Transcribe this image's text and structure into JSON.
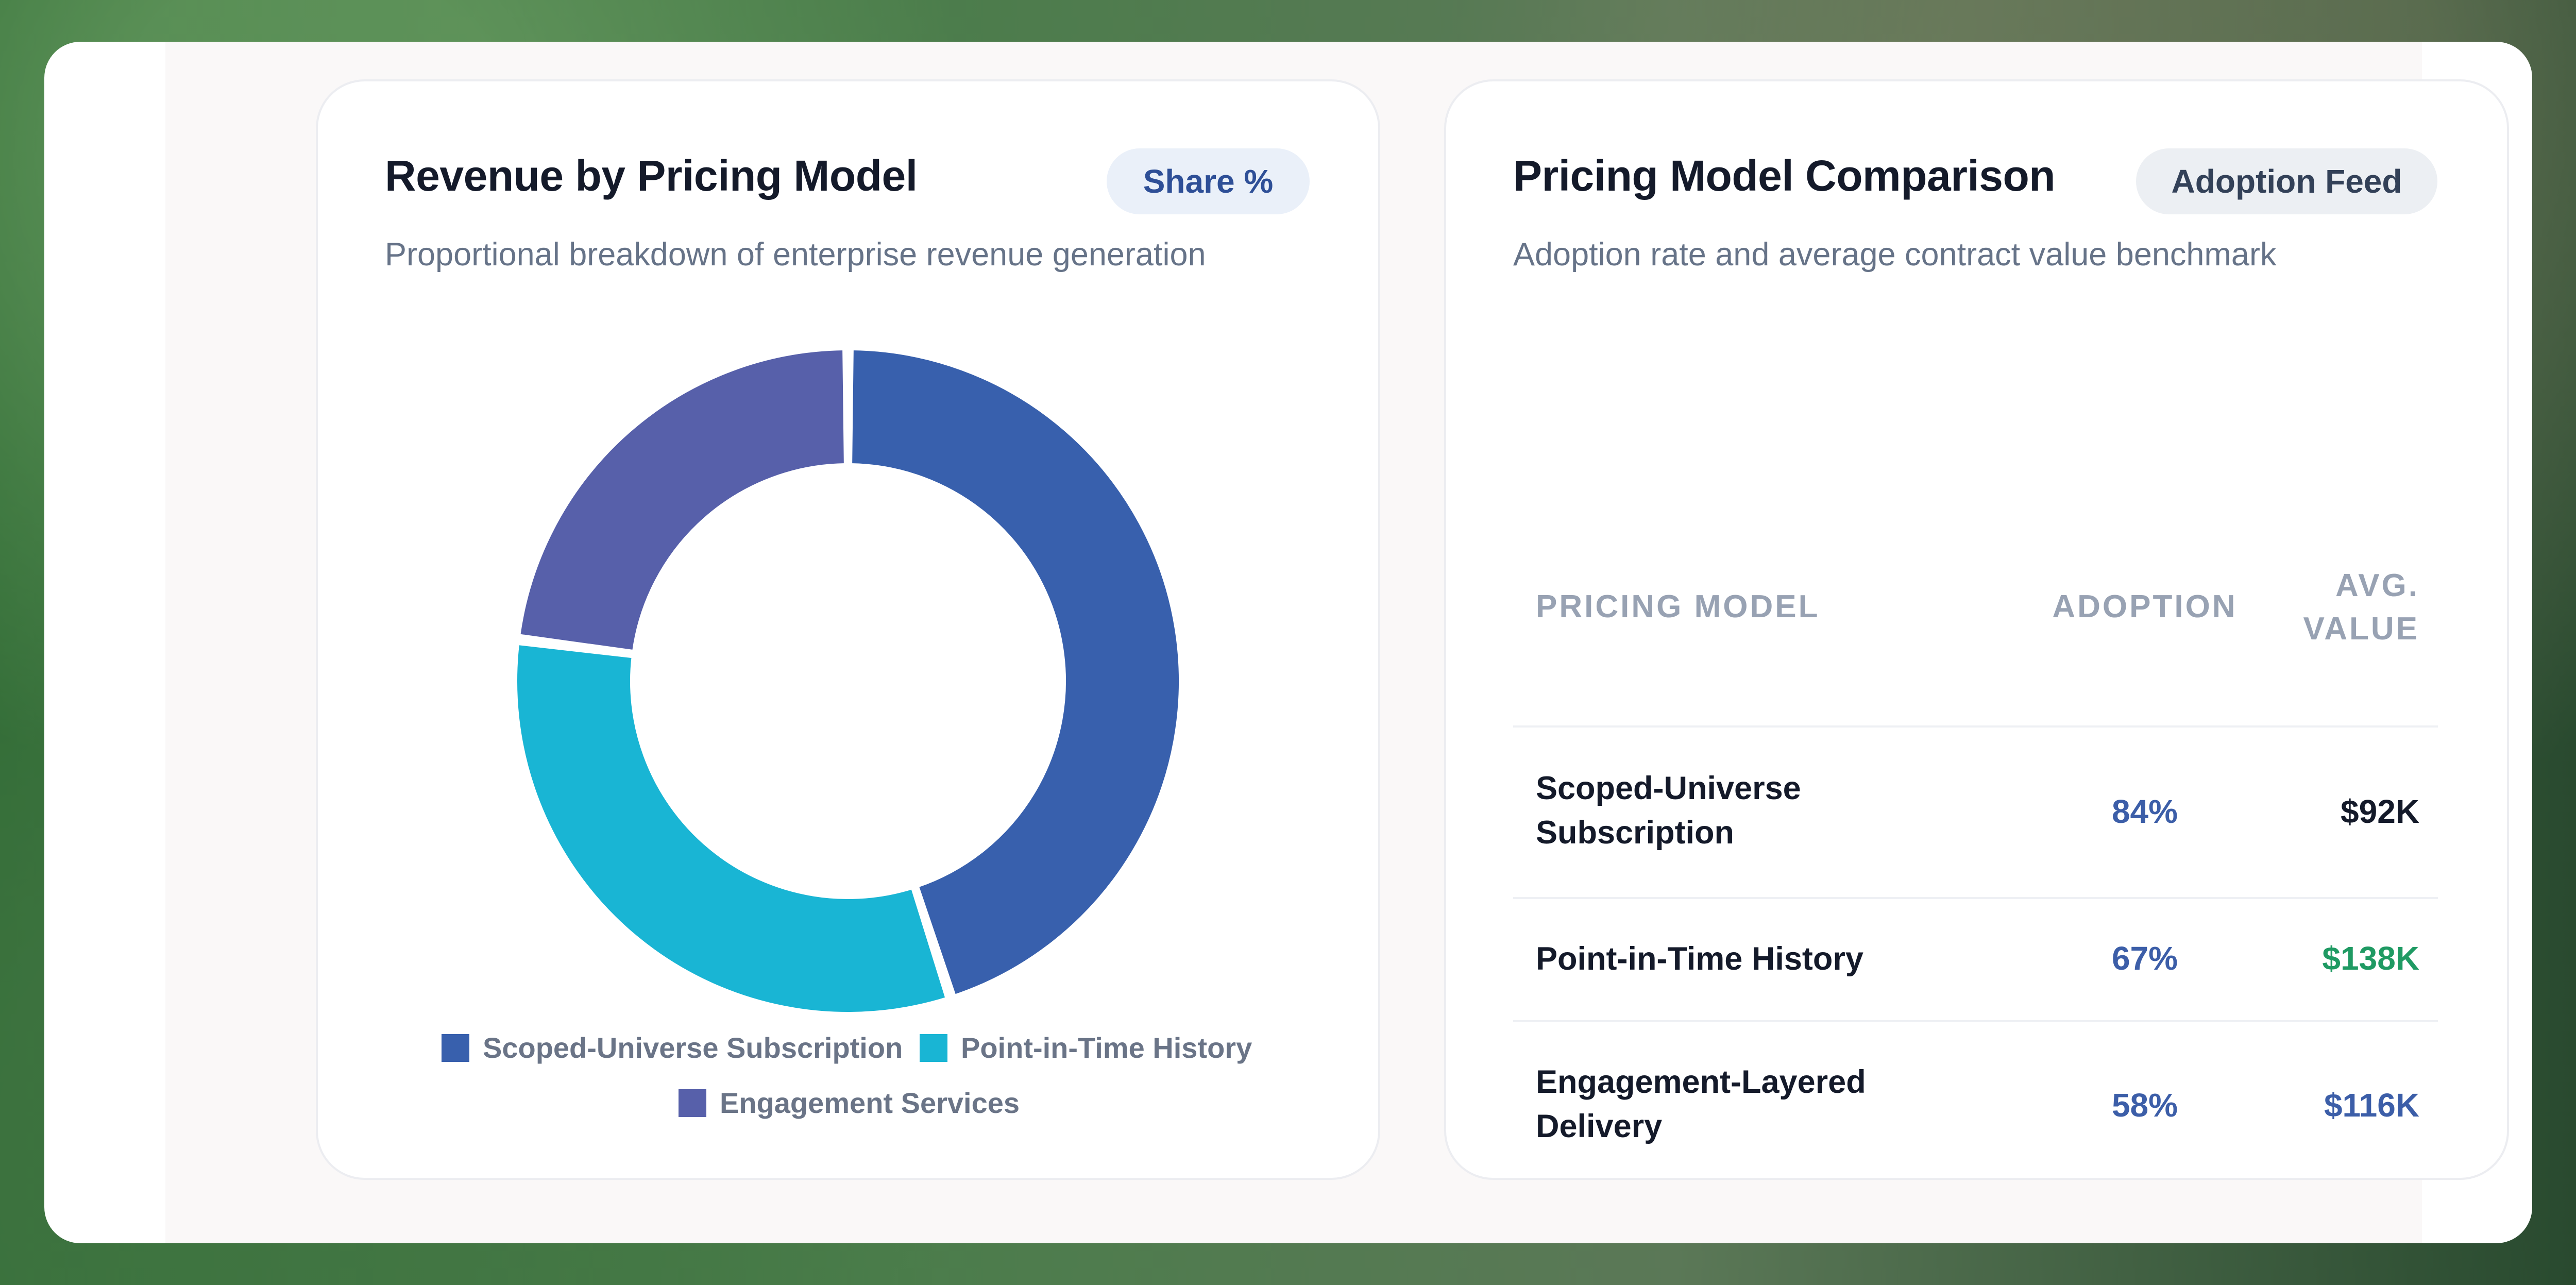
{
  "revenue_card": {
    "title": "Revenue by Pricing Model",
    "badge": "Share %",
    "subtitle": "Proportional breakdown of enterprise revenue generation"
  },
  "comparison_card": {
    "title": "Pricing Model Comparison",
    "badge": "Adoption Feed",
    "subtitle": "Adoption rate and average contract value benchmark",
    "headers": {
      "model": "PRICING MODEL",
      "adoption": "ADOPTION",
      "value_line1": "AVG.",
      "value_line2": "VALUE"
    },
    "rows": [
      {
        "model_line1": "Scoped-Universe",
        "model_line2": "Subscription",
        "adoption": "84%",
        "value": "$92K",
        "value_color": "#141a2a"
      },
      {
        "model_line1": "Point-in-Time History",
        "model_line2": "",
        "adoption": "67%",
        "value": "$138K",
        "value_color": "#1f9a63"
      },
      {
        "model_line1": "Engagement-Layered",
        "model_line2": "Delivery",
        "adoption": "58%",
        "value": "$116K",
        "value_color": "#3c5ea8"
      }
    ]
  },
  "chart_data": {
    "type": "pie",
    "donut": true,
    "title": "Revenue by Pricing Model",
    "categories": [
      "Scoped-Universe Subscription",
      "Point-in-Time History",
      "Engagement Services"
    ],
    "values": [
      45,
      32,
      23
    ],
    "unit": "%",
    "colors": [
      "#3860ad",
      "#19b5d4",
      "#5760aa"
    ],
    "legend": "bottom"
  }
}
